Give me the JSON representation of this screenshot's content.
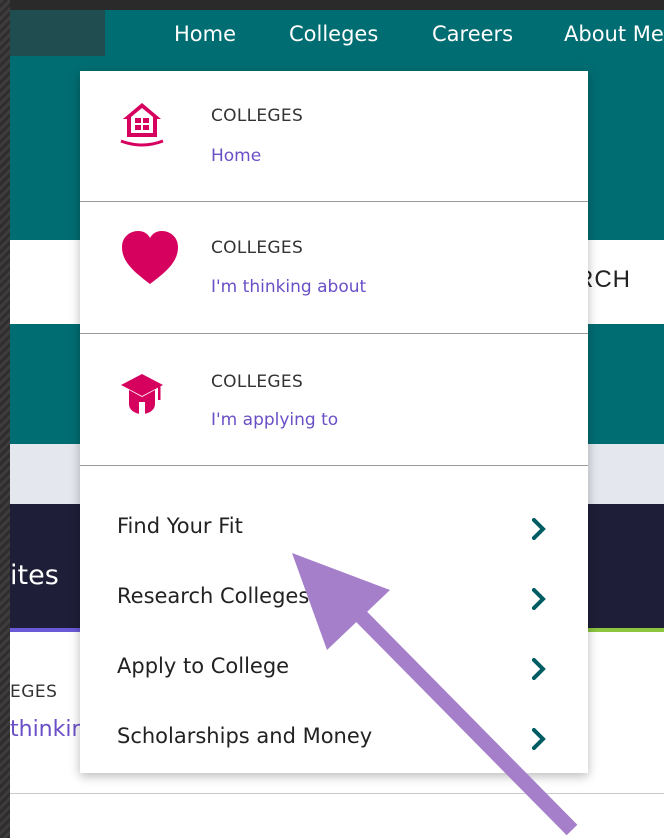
{
  "nav": {
    "items": [
      "Home",
      "Colleges",
      "Careers",
      "About Me"
    ]
  },
  "header": {
    "search_fragment": "RCH"
  },
  "background": {
    "section_title_fragment": "ites",
    "eyebrow_fragment": "EGES",
    "link_fragment": "thinkin"
  },
  "dropdown": {
    "sections": [
      {
        "icon": "house-icon",
        "eyebrow": "COLLEGES",
        "link": "Home"
      },
      {
        "icon": "heart-icon",
        "eyebrow": "COLLEGES",
        "link": "I'm thinking about"
      },
      {
        "icon": "graduation-cap-icon",
        "eyebrow": "COLLEGES",
        "link": "I'm applying to"
      }
    ],
    "menu": [
      {
        "label": "Find Your Fit"
      },
      {
        "label": "Research Colleges"
      },
      {
        "label": "Apply to College"
      },
      {
        "label": "Scholarships and Money"
      }
    ]
  },
  "colors": {
    "teal": "#006d72",
    "navy": "#1e1e38",
    "icon_pink": "#d6005f",
    "link_purple": "#6a4fc6",
    "chevron_teal": "#005c63",
    "annotation_arrow": "#a57fc9"
  }
}
